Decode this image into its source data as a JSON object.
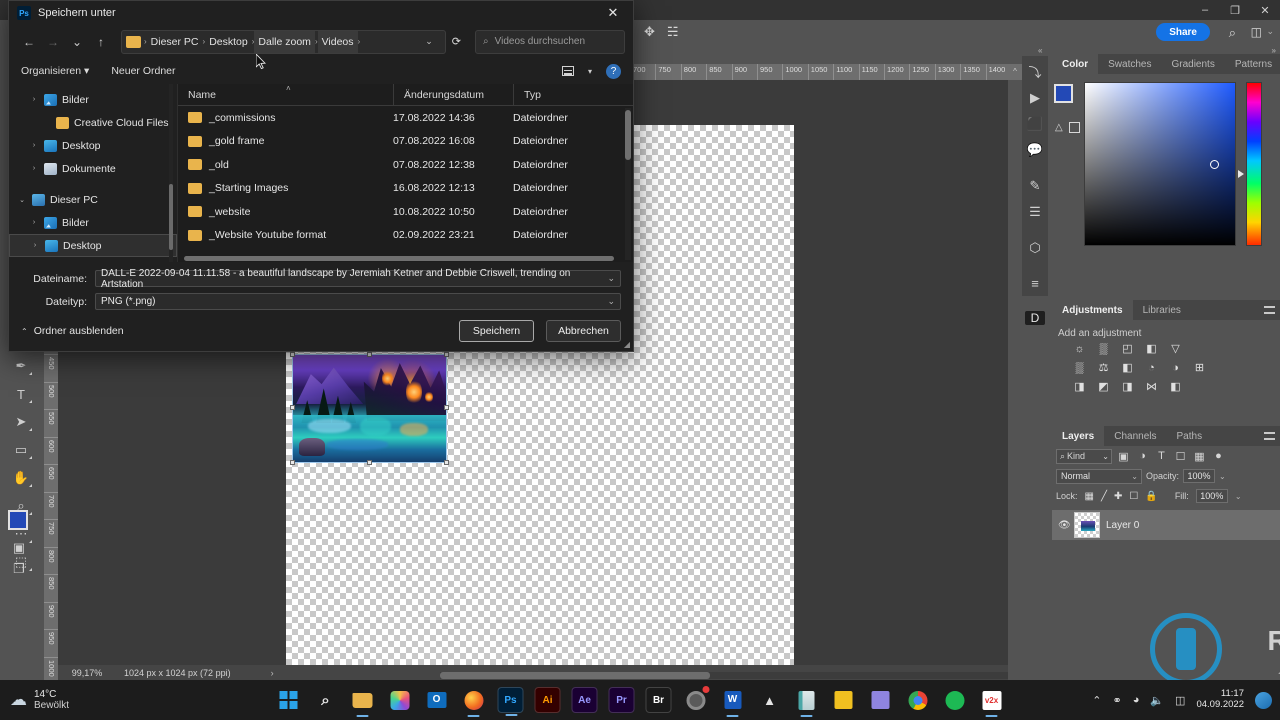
{
  "photoshop": {
    "window_controls": [
      "–",
      "❐",
      "✕"
    ],
    "options_bar": {
      "move_tool_icon": "move-icon",
      "video_icon": "video-icon",
      "share_label": "Share",
      "search_icon": "search-icon",
      "workspace_icon": "workspace-icon",
      "chevron": "⌄"
    },
    "ruler_h": [
      "700",
      "750",
      "800",
      "850",
      "900",
      "950",
      "1000",
      "1050",
      "1100",
      "1150",
      "1200",
      "1250",
      "1300",
      "1350",
      "1400"
    ],
    "ruler_v": [
      "450",
      "500",
      "550",
      "600",
      "650",
      "700",
      "750",
      "800",
      "850",
      "900",
      "950",
      "1000"
    ],
    "status": {
      "zoom": "99,17%",
      "dimensions": "1024 px x 1024 px (72 ppi)",
      "arrow_right": "›",
      "arrow_left": "‹"
    },
    "tools": [
      {
        "name": "pen-tool",
        "glyph": "✒"
      },
      {
        "name": "type-tool",
        "glyph": "T"
      },
      {
        "name": "path-selection-tool",
        "glyph": "➤"
      },
      {
        "name": "rectangle-tool",
        "glyph": "▭"
      },
      {
        "name": "hand-tool",
        "glyph": "✋"
      },
      {
        "name": "zoom-tool",
        "glyph": "⌕"
      },
      {
        "name": "more-tools",
        "glyph": "⋯"
      },
      {
        "name": "default-colors-icon",
        "glyph": "⬚"
      }
    ],
    "dock_strip": [
      {
        "name": "history-icon",
        "glyph": "⤵"
      },
      {
        "name": "actions-play-icon",
        "glyph": "▶"
      },
      {
        "name": "info-icon",
        "glyph": "⬛"
      },
      {
        "name": "comments-icon",
        "glyph": "💬"
      },
      {
        "name": "brush-settings-icon",
        "glyph": "✎"
      },
      {
        "name": "properties-sliders-icon",
        "glyph": "☰"
      },
      {
        "name": "3d-icon",
        "glyph": "⬡"
      },
      {
        "name": "adjust-sliders-icon",
        "glyph": "≡"
      },
      {
        "name": "discover-icon",
        "glyph": "D"
      }
    ],
    "color_panel": {
      "tabs": [
        "Color",
        "Swatches",
        "Gradients",
        "Patterns"
      ],
      "active_tab": "Color",
      "foreground_hex": "#2349b6",
      "background_hex": "#f2907e"
    },
    "adjustments_panel": {
      "tabs": [
        "Adjustments",
        "Libraries"
      ],
      "active_tab": "Adjustments",
      "hint": "Add an adjustment",
      "icons": [
        [
          "brightness-contrast-icon",
          "levels-icon",
          "curves-icon",
          "exposure-icon",
          "vibrance-icon"
        ],
        [
          "hue-saturation-icon",
          "color-balance-icon",
          "black-white-icon",
          "photo-filter-icon",
          "channel-mixer-icon",
          "color-lookup-icon"
        ],
        [
          "invert-icon",
          "posterize-icon",
          "threshold-icon",
          "gradient-map-icon",
          "selective-color-icon"
        ]
      ]
    },
    "layers_panel": {
      "tabs": [
        "Layers",
        "Channels",
        "Paths"
      ],
      "active_tab": "Layers",
      "filter_kind": "Kind",
      "filter_icons": [
        "pixel-filter-icon",
        "adjustment-filter-icon",
        "type-filter-icon",
        "shape-filter-icon",
        "smart-object-filter-icon",
        "filter-toggle-icon"
      ],
      "blend_mode": "Normal",
      "opacity_label": "Opacity:",
      "opacity_value": "100%",
      "lock_label": "Lock:",
      "lock_icons": [
        "lock-transparent-icon",
        "lock-image-icon",
        "lock-position-icon",
        "lock-artboard-icon",
        "lock-all-icon"
      ],
      "fill_label": "Fill:",
      "fill_value": "100%",
      "layers": [
        {
          "name": "Layer 0",
          "visible": true
        }
      ]
    }
  },
  "dialog": {
    "title": "Speichern unter",
    "close_glyph": "✕",
    "nav": {
      "back": "←",
      "forward": "→",
      "recent": "⌄",
      "up": "↑",
      "refresh": "⟳",
      "dropdown": "⌄"
    },
    "breadcrumbs": [
      "Dieser PC",
      "Desktop",
      "Dalle zoom",
      "Videos"
    ],
    "breadcrumb_sep": "›",
    "search_placeholder": "Videos durchsuchen",
    "search_icon": "search-icon",
    "toolbar": {
      "organize": "Organisieren",
      "organize_caret": "▾",
      "new_folder": "Neuer Ordner",
      "view_icon": "view-list-icon",
      "view_caret": "▾",
      "help": "?"
    },
    "tree": [
      {
        "label": "Bilder",
        "chevron": "›",
        "icon": "pictures-icon",
        "indent": 1,
        "selected": false
      },
      {
        "label": "Creative Cloud Files",
        "chevron": "",
        "icon": "folder-icon",
        "indent": 2,
        "selected": false
      },
      {
        "label": "Desktop",
        "chevron": "›",
        "icon": "desktop-icon",
        "indent": 1,
        "selected": false
      },
      {
        "label": "Dokumente",
        "chevron": "›",
        "icon": "documents-icon",
        "indent": 1,
        "selected": false
      },
      {
        "label": "Dieser PC",
        "chevron": "⌄",
        "icon": "pc-icon",
        "indent": 0,
        "selected": false
      },
      {
        "label": "Bilder",
        "chevron": "›",
        "icon": "pictures-icon",
        "indent": 1,
        "selected": false
      },
      {
        "label": "Desktop",
        "chevron": "›",
        "icon": "desktop-icon",
        "indent": 1,
        "selected": true
      }
    ],
    "columns": [
      "Name",
      "Änderungsdatum",
      "Typ"
    ],
    "sort_indicator": "˄",
    "files": [
      {
        "name": "_commissions",
        "modified": "17.08.2022 14:36",
        "type": "Dateiordner"
      },
      {
        "name": "_gold frame",
        "modified": "07.08.2022 16:08",
        "type": "Dateiordner"
      },
      {
        "name": "_old",
        "modified": "07.08.2022 12:38",
        "type": "Dateiordner"
      },
      {
        "name": "_Starting Images",
        "modified": "16.08.2022 12:13",
        "type": "Dateiordner"
      },
      {
        "name": "_website",
        "modified": "10.08.2022 10:50",
        "type": "Dateiordner"
      },
      {
        "name": "_Website Youtube format",
        "modified": "02.09.2022 23:21",
        "type": "Dateiordner"
      }
    ],
    "fields": {
      "filename_label": "Dateiname:",
      "filename_value": "DALL-E 2022-09-04 11.11.58 - a beautiful landscape by Jeremiah Ketner and Debbie Criswell, trending on Artstation",
      "filetype_label": "Dateityp:",
      "filetype_value": "PNG (*.png)",
      "caret": "⌄"
    },
    "footer": {
      "hide_folders": "Ordner ausblenden",
      "hide_chevron": "⌃",
      "save": "Speichern",
      "cancel": "Abbrechen"
    }
  },
  "taskbar": {
    "weather": {
      "temp": "14°C",
      "desc": "Bewölkt",
      "icon": "cloud-icon"
    },
    "items": [
      {
        "name": "start-button",
        "label": "",
        "color": "#0a84d8",
        "kind": "start"
      },
      {
        "name": "search-taskbar-button",
        "label": "⌕",
        "color": "transparent",
        "kind": "search"
      },
      {
        "name": "file-explorer-button",
        "label": "",
        "color": "#e9b44c",
        "kind": "folder",
        "running": true
      },
      {
        "name": "photos-button",
        "label": "",
        "color": "#d94a8c",
        "kind": "photos"
      },
      {
        "name": "outlook-button",
        "label": "",
        "color": "#0f6cbd",
        "kind": "outlook"
      },
      {
        "name": "firefox-button",
        "label": "",
        "color": "#e8622a",
        "kind": "firefox",
        "running": true
      },
      {
        "name": "photoshop-button",
        "label": "Ps",
        "color": "#001e36",
        "kind": "ps",
        "active": true,
        "running": true
      },
      {
        "name": "illustrator-button",
        "label": "Ai",
        "color": "#330000",
        "kind": "ai"
      },
      {
        "name": "aftereffects-button",
        "label": "Ae",
        "color": "#1a0033",
        "kind": "ae"
      },
      {
        "name": "premiere-button",
        "label": "Pr",
        "color": "#1a0033",
        "kind": "pr"
      },
      {
        "name": "bridge-button",
        "label": "Br",
        "color": "#1a1a1a",
        "kind": "br"
      },
      {
        "name": "chrome-canary-button",
        "label": "",
        "color": "#d6a11f",
        "kind": "canary",
        "badge": true
      },
      {
        "name": "word-button",
        "label": "W",
        "color": "#185abd",
        "kind": "word",
        "running": true
      },
      {
        "name": "onedrive-button",
        "label": "▲",
        "color": "transparent",
        "kind": "cloud"
      },
      {
        "name": "notepad-button",
        "label": "",
        "color": "#4aa6a6",
        "kind": "notepad",
        "running": true
      },
      {
        "name": "notes-button",
        "label": "",
        "color": "#f0c020",
        "kind": "notes"
      },
      {
        "name": "snipping-tool-button",
        "label": "",
        "color": "#7a6fd6",
        "kind": "snip"
      },
      {
        "name": "chrome-button",
        "label": "",
        "color": "#ffffff",
        "kind": "chrome"
      },
      {
        "name": "spotify-button",
        "label": "",
        "color": "#1db954",
        "kind": "spotify"
      },
      {
        "name": "v2x-button",
        "label": "v2x",
        "color": "#ffffff",
        "kind": "v2x",
        "running": true
      }
    ],
    "tray": {
      "overflow": "⌃",
      "icons": [
        "usb-icon",
        "wifi-icon",
        "volume-icon",
        "battery-icon"
      ],
      "time": "11:17",
      "date": "04.09.2022"
    }
  }
}
